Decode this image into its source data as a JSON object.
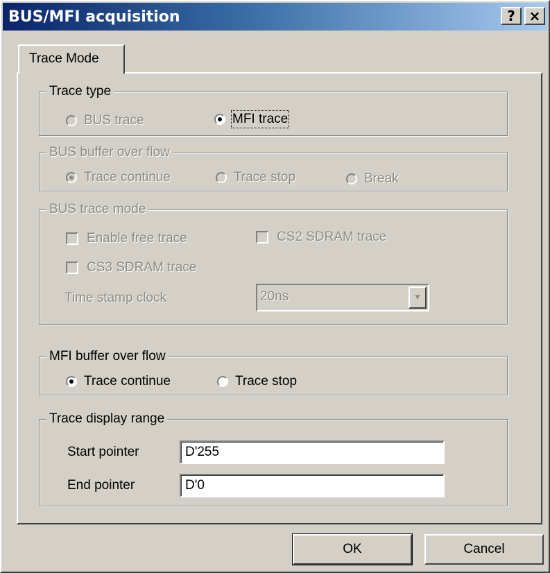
{
  "window": {
    "title": "BUS/MFI acquisition",
    "help_label": "?",
    "close_label": "×"
  },
  "tabs": [
    {
      "label": "Trace Mode",
      "active": true
    }
  ],
  "trace_type": {
    "legend": "Trace type",
    "bus_trace": "BUS trace",
    "mfi_trace": "MFI trace",
    "selected": "mfi_trace"
  },
  "bus_buffer_overflow": {
    "legend": "BUS buffer over flow",
    "trace_continue": "Trace continue",
    "trace_stop": "Trace stop",
    "break": "Break",
    "selected": "trace_continue",
    "enabled": false
  },
  "bus_trace_mode": {
    "legend": "BUS trace mode",
    "enable_free_trace": "Enable free trace",
    "cs2_sdram_trace": "CS2 SDRAM trace",
    "cs3_sdram_trace": "CS3 SDRAM trace",
    "time_stamp_label": "Time stamp clock",
    "time_stamp_value": "20ns",
    "enabled": false
  },
  "mfi_buffer_overflow": {
    "legend": "MFI buffer over flow",
    "trace_continue": "Trace continue",
    "trace_stop": "Trace stop",
    "selected": "trace_continue"
  },
  "trace_display_range": {
    "legend": "Trace display range",
    "start_label": "Start pointer",
    "start_value": "D'255",
    "end_label": "End pointer",
    "end_value": "D'0"
  },
  "buttons": {
    "ok": "OK",
    "cancel": "Cancel"
  }
}
